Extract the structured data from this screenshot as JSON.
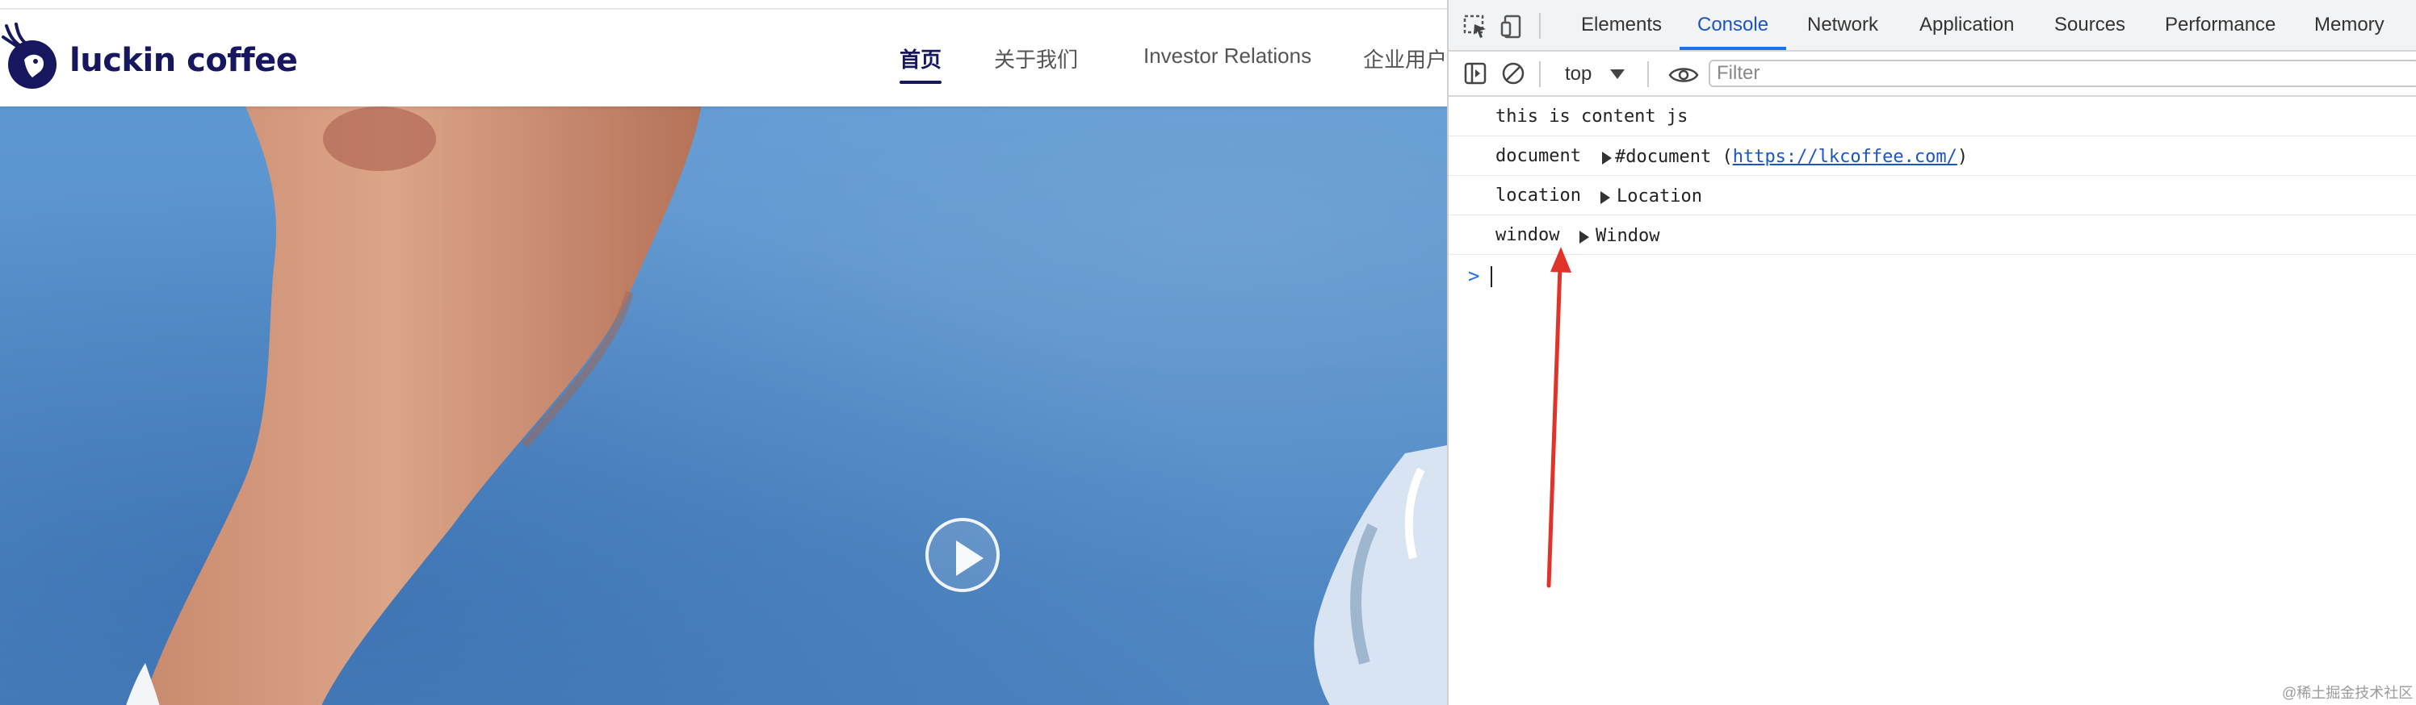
{
  "site": {
    "logo_text": "luckin coffee",
    "nav": {
      "items": [
        {
          "label": "首页",
          "active": true
        },
        {
          "label": "关于我们",
          "active": false
        },
        {
          "label": "Investor Relations",
          "active": false
        },
        {
          "label": "企业用户",
          "active": false
        }
      ]
    },
    "hero": {
      "play_icon": "play-circle-icon"
    }
  },
  "devtools": {
    "tabs": [
      "Elements",
      "Console",
      "Network",
      "Application",
      "Sources",
      "Performance",
      "Memory"
    ],
    "active_tab": "Console",
    "toolbar": {
      "context": "top",
      "filter_placeholder": "Filter"
    },
    "console": {
      "messages": [
        {
          "key": "this is content js",
          "value": ""
        },
        {
          "key": "document",
          "value": "#document (",
          "link": "https://lkcoffee.com/",
          "suffix": ")"
        },
        {
          "key": "location",
          "value": "Location"
        },
        {
          "key": "window",
          "value": "Window"
        }
      ],
      "prompt": ">"
    }
  },
  "watermark": "@稀土掘金技术社区",
  "colors": {
    "brand": "#16175f",
    "devtools_accent": "#1a73e8",
    "annotation_arrow": "#e0332a"
  }
}
